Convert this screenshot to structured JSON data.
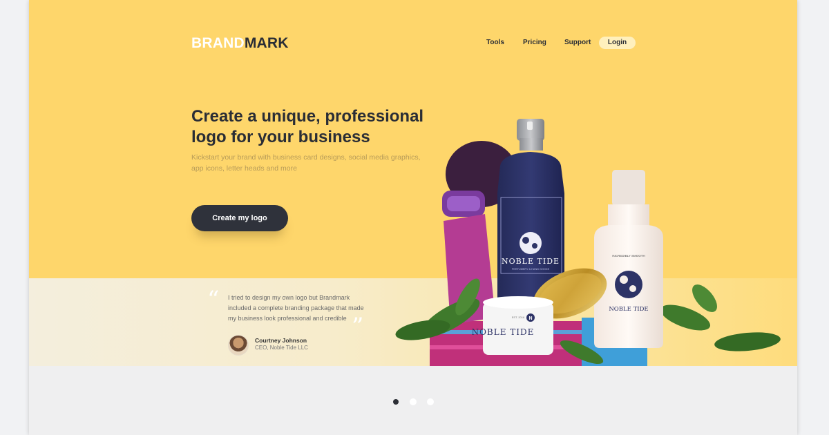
{
  "brand": {
    "part1": "BRAND",
    "part2": "MARK"
  },
  "nav": {
    "tools": "Tools",
    "pricing": "Pricing",
    "support": "Support",
    "login": "Login"
  },
  "hero": {
    "headline_line1": "Create a unique, professional",
    "headline_line2": "logo for your business",
    "subtitle": "Kickstart your brand with business card designs, social media graphics, app icons, letter heads and more",
    "cta": "Create my logo"
  },
  "product_labels": {
    "bottle_brand": "NOBLE TIDE",
    "bottle_tagline": "PERFUMERY & HAND GOODS",
    "lotion_brand": "NOBLE TIDE",
    "lotion_top": "INCREDIBLY SMOOTH",
    "jar_brand": "NOBLE TIDE",
    "jar_letter": "N",
    "jar_est": "EST. 2016"
  },
  "testimonial": {
    "quote": "I tried to design my own logo but Brandmark included a complete branding package that made my business look professional and credible",
    "author_name": "Courtney Johnson",
    "author_title": "CEO, Noble Tide LLC",
    "open_mark": "“",
    "close_mark": "”"
  },
  "carousel": {
    "total": 3,
    "active": 1
  },
  "colors": {
    "hero_bg": "#fed66b",
    "cta_bg": "#2f323b",
    "brand_white": "#ffffff",
    "navy": "#2d3366"
  },
  "icons": [
    "quote-icon",
    "carousel-dot"
  ]
}
